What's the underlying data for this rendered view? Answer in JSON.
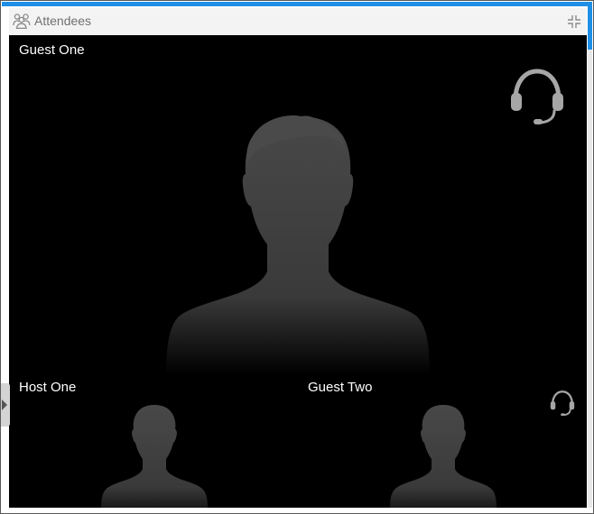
{
  "panel": {
    "title": "Attendees",
    "title_icon": "people-icon",
    "collapse_icon": "collapse-icon"
  },
  "tiles": [
    {
      "name": "Guest One",
      "status_icon": "headset-icon"
    },
    {
      "name": "Host One"
    },
    {
      "name": "Guest Two",
      "status_icon": "headset-icon"
    }
  ],
  "colors": {
    "accent": "#1e8fe6",
    "stage_background": "#000000",
    "silhouette": "#4a4a4a",
    "headset": "#a6a6a6"
  }
}
